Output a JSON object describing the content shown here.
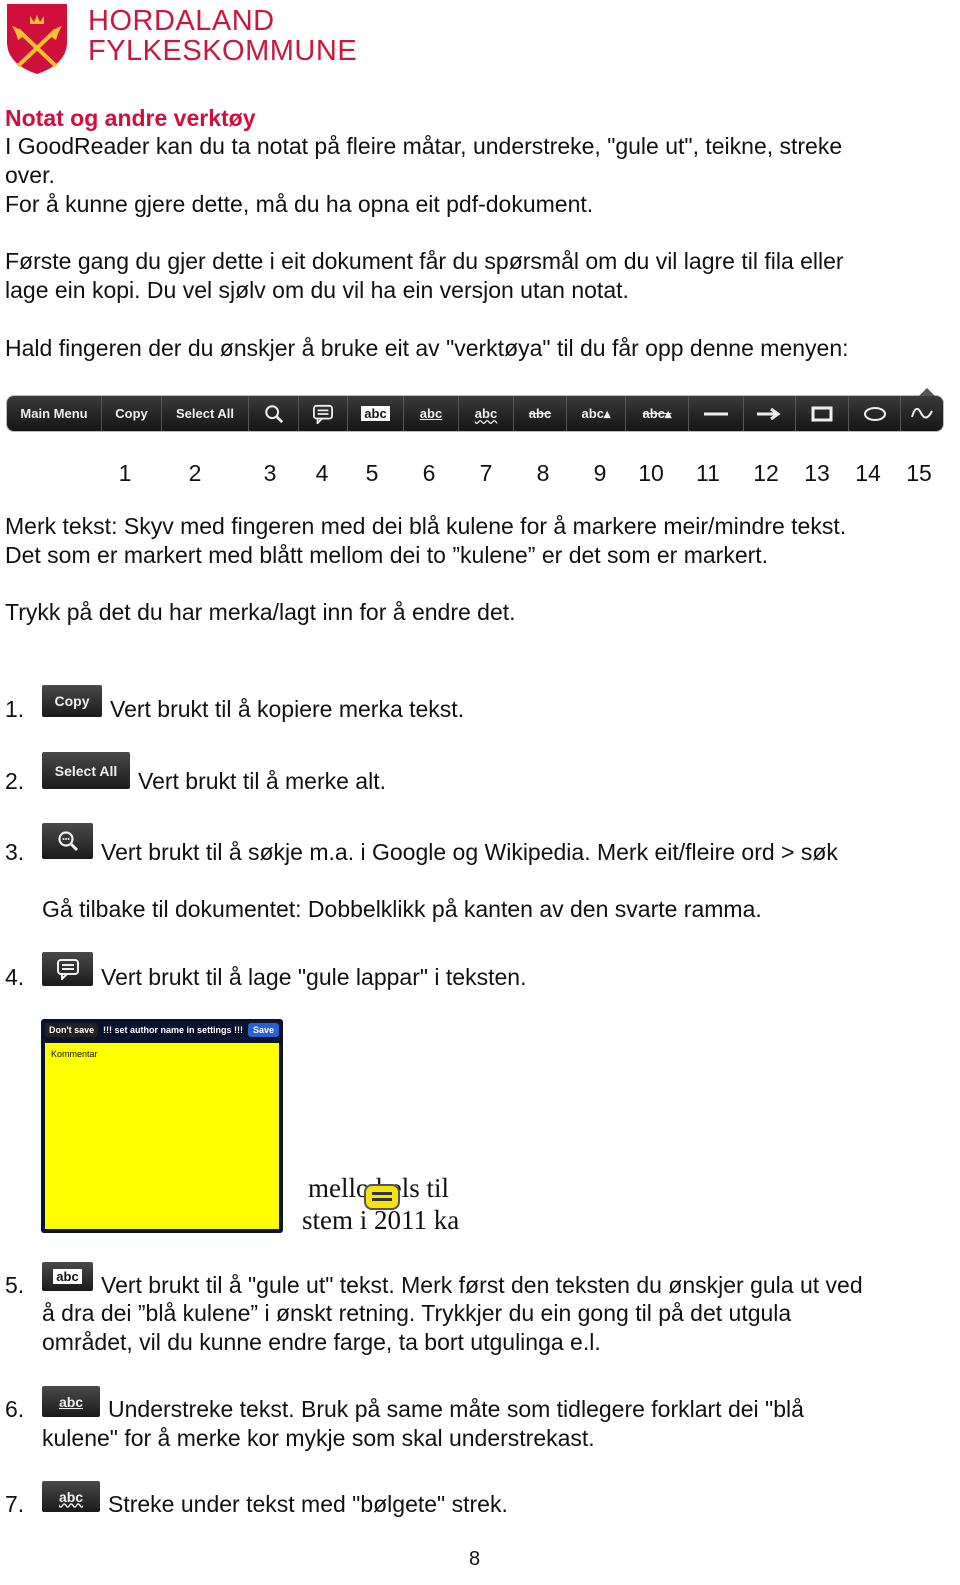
{
  "logo": {
    "line1": "HORDALAND",
    "line2": "FYLKESKOMMUNE",
    "color": "#d0103a"
  },
  "title": "Notat og andre verktøy",
  "intro": [
    "I GoodReader kan du ta notat på fleire måtar, understreke, \"gule ut\", teikne, streke",
    "over.",
    "For å kunne gjere dette, må du ha opna eit pdf-dokument.",
    "Første gang du gjer dette i eit dokument får du spørsmål om du vil lagre til fila eller",
    "lage ein kopi. Du vel sjølv om du vil ha ein versjon utan notat.",
    "Hald fingeren der du ønskjer å bruke eit av \"verktøya\" til du får opp denne menyen:"
  ],
  "toolbar": [
    {
      "label": "Main Menu",
      "icon": "text"
    },
    {
      "label": "Copy",
      "icon": "text"
    },
    {
      "label": "Select All",
      "icon": "text"
    },
    {
      "label": "",
      "icon": "search-icon"
    },
    {
      "label": "",
      "icon": "note-icon"
    },
    {
      "label": "abc",
      "icon": "highlight-icon"
    },
    {
      "label": "abc",
      "icon": "underline-icon"
    },
    {
      "label": "abc",
      "icon": "squiggly-icon"
    },
    {
      "label": "abc",
      "icon": "strikeout-icon"
    },
    {
      "label": "abc",
      "icon": "insert-text-icon"
    },
    {
      "label": "abc",
      "icon": "replace-text-icon"
    },
    {
      "label": "",
      "icon": "line-icon"
    },
    {
      "label": "",
      "icon": "arrow-icon"
    },
    {
      "label": "",
      "icon": "rectangle-icon"
    },
    {
      "label": "",
      "icon": "oval-icon"
    },
    {
      "label": "",
      "icon": "freehand-icon"
    }
  ],
  "numbers": [
    "1",
    "2",
    "3",
    "4",
    "5",
    "6",
    "7",
    "8",
    "9",
    "10",
    "11",
    "12",
    "13",
    "14",
    "15"
  ],
  "mark": [
    "Merk tekst: Skyv med fingeren med dei blå kulene for å markere meir/mindre tekst.",
    "Det som er markert med blått mellom dei to ”kulene” er det som er markert.",
    "Trykk på det du har merka/lagt inn for å endre det."
  ],
  "items": [
    {
      "n": "1.",
      "btn": "Copy",
      "text": "Vert brukt til å kopiere merka tekst."
    },
    {
      "n": "2.",
      "btn": "Select All",
      "text": "Vert brukt til å merke alt."
    },
    {
      "n": "3.",
      "btn": "",
      "text": "Vert brukt til å søkje m.a. i Google og Wikipedia. Merk eit/fleire ord > søk",
      "extra": "Gå tilbake til dokumentet: Dobbelklikk på kanten av den svarte ramma."
    },
    {
      "n": "4.",
      "btn": "",
      "text": "Vert brukt til å lage \"gule lappar\" i teksten."
    },
    {
      "n": "5.",
      "btn": "abc",
      "text": "Vert brukt til å \"gule ut\" tekst. Merk først den teksten du ønskjer gula ut ved",
      "l2": "å dra dei ”blå kulene” i ønskt retning. Trykkjer du ein gong til på det utgula",
      "l3": "området, vil du kunne endre farge, ta bort utgulinga e.l."
    },
    {
      "n": "6.",
      "btn": "abc",
      "text": "Understreke tekst. Bruk på same måte som tidlegere forklart dei \"blå",
      "l2": "kulene\" for å merke kor mykje som skal understrekast."
    },
    {
      "n": "7.",
      "btn": "abc",
      "text": "Streke under tekst med \"bølgete\" strek."
    }
  ],
  "note": {
    "dont_save": "Don't save",
    "title": "!!! set author name in settings !!!",
    "save": "Save",
    "content": "Kommentar",
    "snippet1": "mello  bels til",
    "snippet2": "stem i 2011 ka"
  },
  "page": "8"
}
